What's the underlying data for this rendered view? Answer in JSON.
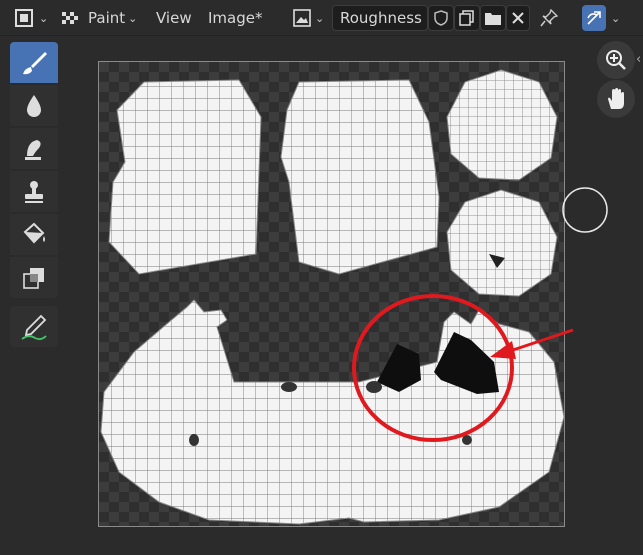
{
  "header": {
    "mode_label": "Paint",
    "menu": {
      "view": "View",
      "image": "Image*"
    },
    "image_name": "Roughness"
  },
  "colors": {
    "accent": "#4772b3",
    "annotation": "#e0191f"
  },
  "toolbar": {
    "tools": [
      {
        "name": "draw-brush-icon",
        "active": true
      },
      {
        "name": "blur-drop-icon",
        "active": false
      },
      {
        "name": "smear-icon",
        "active": false
      },
      {
        "name": "clone-stamp-icon",
        "active": false
      },
      {
        "name": "fill-bucket-icon",
        "active": false
      },
      {
        "name": "mask-icon",
        "active": false
      },
      {
        "name": "annotate-icon",
        "active": false
      }
    ]
  }
}
